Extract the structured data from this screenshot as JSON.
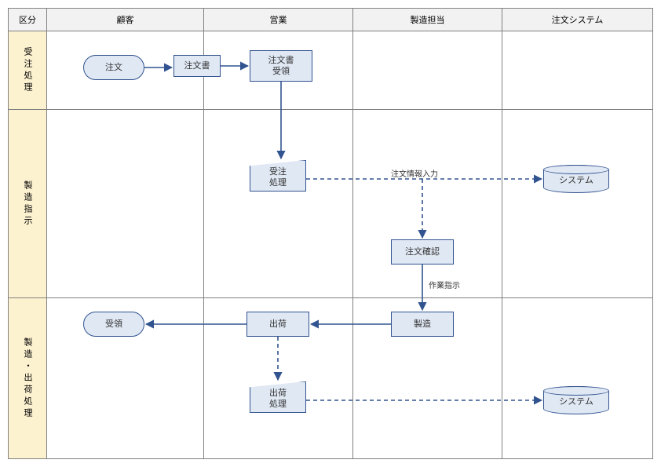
{
  "headers": {
    "category": "区分",
    "customer": "顧客",
    "sales": "営業",
    "manufacturing": "製造担当",
    "system": "注文システム"
  },
  "phases": {
    "p1": "受注処理",
    "p2": "製造指示",
    "p3": "製造・出荷処理"
  },
  "nodes": {
    "order": "注文",
    "orderForm": "注文書",
    "orderFormReceive": "注文書\n受領",
    "orderProc": "受注\n処理",
    "systemA": "システム",
    "orderConfirm": "注文確認",
    "manufacture": "製造",
    "ship": "出荷",
    "receive": "受領",
    "shipProc": "出荷\n処理",
    "systemB": "システム"
  },
  "edgeLabels": {
    "enterOrderInfo": "注文情報入力",
    "workOrder": "作業指示"
  }
}
